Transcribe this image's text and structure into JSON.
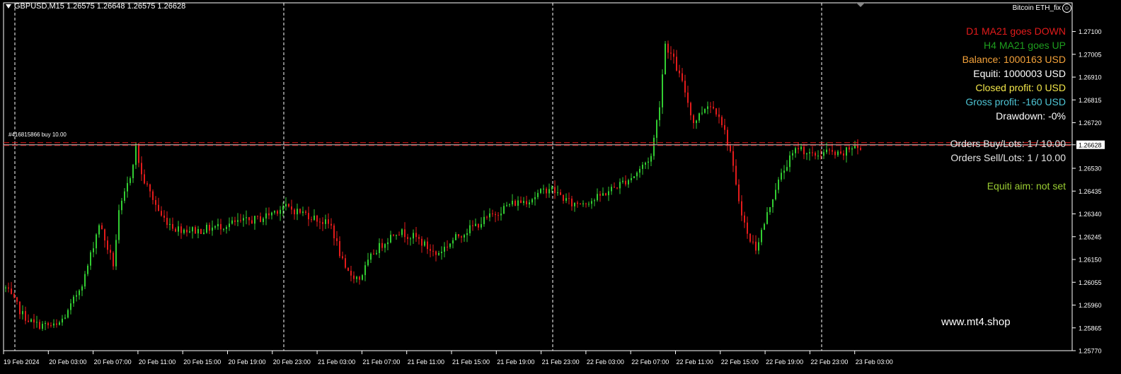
{
  "header": {
    "symbol_info": "GBPUSD,M15  1.26575 1.26648 1.26575 1.26628",
    "ea_name": "Bitcoin ETH_fix",
    "ea_icon": "smiley-icon"
  },
  "order_tag": "#416815866 buy 10.00",
  "info_panel": {
    "lines": [
      {
        "text": "D1 MA21 goes DOWN",
        "color": "#E31B1B"
      },
      {
        "text": "H4 MA21 goes UP",
        "color": "#1E9E1E"
      },
      {
        "text": "Balance: 1000163 USD",
        "color": "#F4A23A"
      },
      {
        "text": "Equiti: 1000003 USD",
        "color": "#FFFFFF"
      },
      {
        "text": "Closed profit: 0 USD",
        "color": "#F2E64A"
      },
      {
        "text": "Gross profit: -160 USD",
        "color": "#4FC6D6"
      },
      {
        "text": "Drawdown: -0%",
        "color": "#FFFFFF"
      },
      {
        "text": "Orders Buy/Lots: 1 / 10.00",
        "color": "#E6E6E6"
      },
      {
        "text": "Orders Sell/Lots: 1 / 10.00",
        "color": "#E6E6E6"
      },
      {
        "text": "Equiti aim: not set",
        "color": "#9ACD32"
      }
    ]
  },
  "watermark": "www.mt4.shop",
  "colors": {
    "background": "#000000",
    "bull": "#32CD32",
    "bear": "#E31B1B",
    "grid": "#FFFFFF",
    "price_line": "#C0C0C0",
    "order_line": "#E31B1B",
    "price_badge_bg": "#FFFFFF",
    "price_badge_text": "#000000"
  },
  "chart_data": {
    "type": "candlestick",
    "symbol": "GBPUSD",
    "timeframe": "M15",
    "ylim": [
      1.2577,
      1.2714
    ],
    "y_ticks": [
      "1.27100",
      "1.27005",
      "1.26910",
      "1.26815",
      "1.26720",
      "1.26628",
      "1.26530",
      "1.26435",
      "1.26340",
      "1.26245",
      "1.26150",
      "1.26055",
      "1.25960",
      "1.25865",
      "1.25770"
    ],
    "current_price": "1.26628",
    "x_ticks": [
      "19 Feb 2024",
      "20 Feb 03:00",
      "20 Feb 07:00",
      "20 Feb 11:00",
      "20 Feb 15:00",
      "20 Feb 19:00",
      "20 Feb 23:00",
      "21 Feb 03:00",
      "21 Feb 07:00",
      "21 Feb 11:00",
      "21 Feb 15:00",
      "21 Feb 19:00",
      "21 Feb 23:00",
      "22 Feb 03:00",
      "22 Feb 07:00",
      "22 Feb 11:00",
      "22 Feb 15:00",
      "22 Feb 19:00",
      "22 Feb 23:00",
      "23 Feb 03:00"
    ],
    "day_separators": [
      "20 Feb 00:00",
      "21 Feb 00:00",
      "22 Feb 00:00",
      "23 Feb 00:00"
    ],
    "close_path": [
      [
        0,
        1.2603
      ],
      [
        6,
        1.2592
      ],
      [
        10,
        1.2588
      ],
      [
        18,
        1.2587
      ],
      [
        22,
        1.2593
      ],
      [
        28,
        1.2608
      ],
      [
        33,
        1.263
      ],
      [
        38,
        1.2613
      ],
      [
        40,
        1.2634
      ],
      [
        44,
        1.265
      ],
      [
        46,
        1.2662
      ],
      [
        48,
        1.265
      ],
      [
        55,
        1.2633
      ],
      [
        60,
        1.2628
      ],
      [
        68,
        1.2627
      ],
      [
        80,
        1.263
      ],
      [
        90,
        1.2632
      ],
      [
        98,
        1.2637
      ],
      [
        106,
        1.2634
      ],
      [
        115,
        1.2629
      ],
      [
        120,
        1.261
      ],
      [
        125,
        1.2607
      ],
      [
        130,
        1.2618
      ],
      [
        138,
        1.2627
      ],
      [
        145,
        1.2624
      ],
      [
        152,
        1.2617
      ],
      [
        160,
        1.2625
      ],
      [
        170,
        1.2632
      ],
      [
        178,
        1.2638
      ],
      [
        185,
        1.264
      ],
      [
        192,
        1.2645
      ],
      [
        200,
        1.2638
      ],
      [
        208,
        1.264
      ],
      [
        215,
        1.2645
      ],
      [
        222,
        1.265
      ],
      [
        228,
        1.2658
      ],
      [
        231,
        1.268
      ],
      [
        233,
        1.2705
      ],
      [
        236,
        1.2698
      ],
      [
        240,
        1.2685
      ],
      [
        243,
        1.2672
      ],
      [
        248,
        1.268
      ],
      [
        252,
        1.2676
      ],
      [
        256,
        1.266
      ],
      [
        258,
        1.2645
      ],
      [
        262,
        1.2625
      ],
      [
        265,
        1.262
      ],
      [
        268,
        1.263
      ],
      [
        272,
        1.2645
      ],
      [
        276,
        1.2655
      ],
      [
        280,
        1.2662
      ],
      [
        285,
        1.2658
      ],
      [
        290,
        1.266
      ],
      [
        295,
        1.2658
      ],
      [
        300,
        1.2663
      ],
      [
        302,
        1.266
      ]
    ],
    "n_candles": 303
  }
}
